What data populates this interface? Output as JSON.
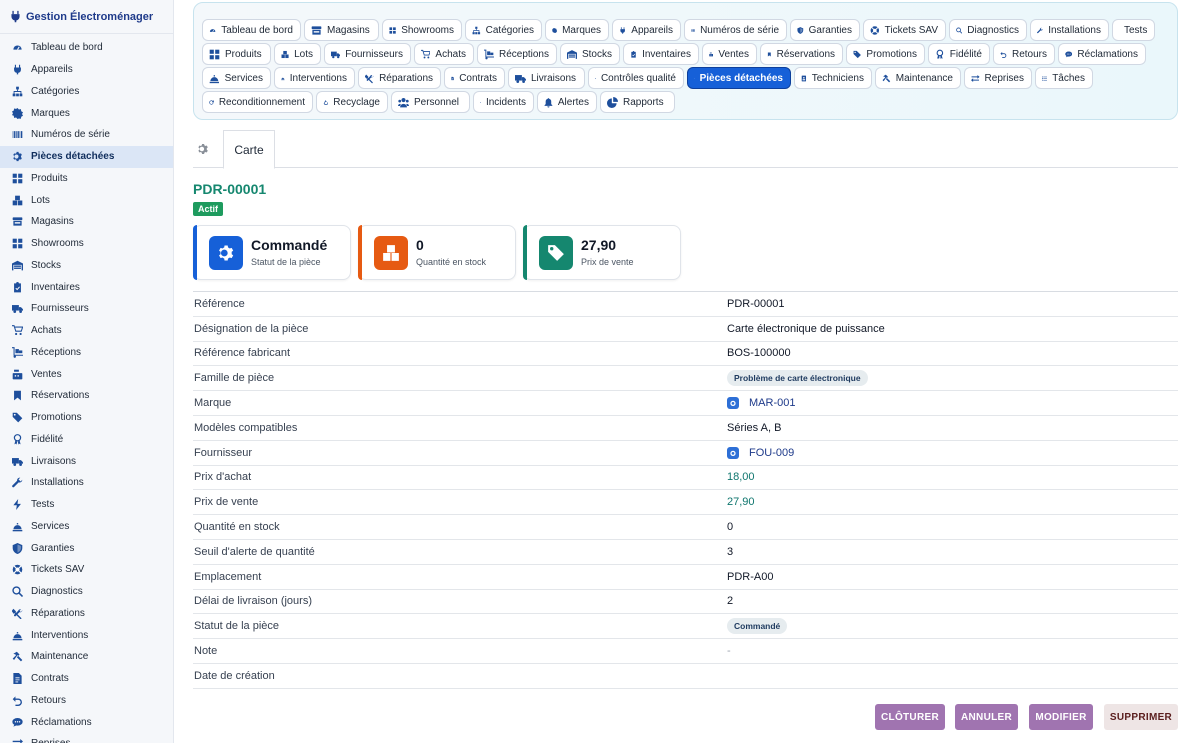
{
  "app": {
    "title": "Gestion Électroménager"
  },
  "colors": {
    "primary_blue": "#1660d8",
    "teal": "#15876f",
    "orange": "#e65a12",
    "green": "#1e9b5e",
    "purple_button": "#a074b0"
  },
  "sidebar": {
    "active": "Pièces détachées",
    "items": [
      {
        "label": "Tableau de bord",
        "icon": "dashboard-icon"
      },
      {
        "label": "Appareils",
        "icon": "plug-icon"
      },
      {
        "label": "Catégories",
        "icon": "sitemap-icon"
      },
      {
        "label": "Marques",
        "icon": "badge-icon"
      },
      {
        "label": "Numéros de série",
        "icon": "barcode-icon"
      },
      {
        "label": "Pièces détachées",
        "icon": "gear-icon"
      },
      {
        "label": "Produits",
        "icon": "grid-icon"
      },
      {
        "label": "Lots",
        "icon": "boxes-icon"
      },
      {
        "label": "Magasins",
        "icon": "store-icon"
      },
      {
        "label": "Showrooms",
        "icon": "showroom-icon"
      },
      {
        "label": "Stocks",
        "icon": "warehouse-icon"
      },
      {
        "label": "Inventaires",
        "icon": "clipboard-icon"
      },
      {
        "label": "Fournisseurs",
        "icon": "truck-icon"
      },
      {
        "label": "Achats",
        "icon": "cart-icon"
      },
      {
        "label": "Réceptions",
        "icon": "dolly-icon"
      },
      {
        "label": "Ventes",
        "icon": "cash-register-icon"
      },
      {
        "label": "Réservations",
        "icon": "bookmark-icon"
      },
      {
        "label": "Promotions",
        "icon": "tags-icon"
      },
      {
        "label": "Fidélité",
        "icon": "award-icon"
      },
      {
        "label": "Livraisons",
        "icon": "truck-icon"
      },
      {
        "label": "Installations",
        "icon": "wrench-icon"
      },
      {
        "label": "Tests",
        "icon": "bolt-icon"
      },
      {
        "label": "Services",
        "icon": "service-icon"
      },
      {
        "label": "Garanties",
        "icon": "shield-icon"
      },
      {
        "label": "Tickets SAV",
        "icon": "lifebuoy-icon"
      },
      {
        "label": "Diagnostics",
        "icon": "search-icon"
      },
      {
        "label": "Réparations",
        "icon": "tools-icon"
      },
      {
        "label": "Interventions",
        "icon": "service-icon"
      },
      {
        "label": "Maintenance",
        "icon": "hammer-icon"
      },
      {
        "label": "Contrats",
        "icon": "file-icon"
      },
      {
        "label": "Retours",
        "icon": "undo-icon"
      },
      {
        "label": "Réclamations",
        "icon": "comment-icon"
      },
      {
        "label": "Reprises",
        "icon": "exchange-icon"
      }
    ]
  },
  "tabs": {
    "row1": [
      {
        "label": "Tableau de bord",
        "icon": "dashboard-icon"
      },
      {
        "label": "Magasins",
        "icon": "store-icon"
      },
      {
        "label": "Showrooms",
        "icon": "showroom-icon"
      },
      {
        "label": "Catégories",
        "icon": "sitemap-icon"
      },
      {
        "label": "Marques",
        "icon": "badge-icon"
      },
      {
        "label": "Appareils",
        "icon": "plug-icon"
      },
      {
        "label": "Numéros de série",
        "icon": "barcode-icon"
      },
      {
        "label": "Garanties",
        "icon": "shield-icon"
      },
      {
        "label": "Tickets SAV",
        "icon": "lifebuoy-icon"
      },
      {
        "label": "Diagnostics",
        "icon": "search-icon"
      },
      {
        "label": "Installations",
        "icon": "wrench-icon"
      },
      {
        "label": "Tests",
        "icon": "bolt-icon"
      }
    ],
    "row2": [
      {
        "label": "Produits",
        "icon": "grid-icon"
      },
      {
        "label": "Lots",
        "icon": "boxes-icon"
      },
      {
        "label": "Fournisseurs",
        "icon": "truck-icon"
      },
      {
        "label": "Achats",
        "icon": "cart-icon"
      },
      {
        "label": "Réceptions",
        "icon": "dolly-icon"
      },
      {
        "label": "Stocks",
        "icon": "warehouse-icon"
      },
      {
        "label": "Inventaires",
        "icon": "clipboard-icon"
      },
      {
        "label": "Ventes",
        "icon": "cash-register-icon"
      },
      {
        "label": "Réservations",
        "icon": "bookmark-icon"
      },
      {
        "label": "Promotions",
        "icon": "tags-icon"
      },
      {
        "label": "Fidélité",
        "icon": "award-icon"
      },
      {
        "label": "Retours",
        "icon": "undo-icon"
      },
      {
        "label": "Réclamations",
        "icon": "comment-icon"
      }
    ],
    "row3": [
      {
        "label": "Services",
        "icon": "service-icon"
      },
      {
        "label": "Interventions",
        "icon": "service-icon"
      },
      {
        "label": "Réparations",
        "icon": "tools-icon"
      },
      {
        "label": "Contrats",
        "icon": "file-icon"
      },
      {
        "label": "Livraisons",
        "icon": "truck-icon"
      },
      {
        "label": "Contrôles qualité",
        "icon": "clipboard-icon"
      },
      {
        "label": "Pièces détachées",
        "icon": "gear-icon",
        "active": true
      },
      {
        "label": "Techniciens",
        "icon": "id-card-icon"
      },
      {
        "label": "Maintenance",
        "icon": "hammer-icon"
      },
      {
        "label": "Reprises",
        "icon": "exchange-icon"
      },
      {
        "label": "Tâches",
        "icon": "list-icon"
      }
    ],
    "row4": [
      {
        "label": "Reconditionnement",
        "icon": "redo-icon"
      },
      {
        "label": "Recyclage",
        "icon": "recycle-icon"
      },
      {
        "label": "Personnel",
        "icon": "users-icon"
      },
      {
        "label": "Incidents",
        "icon": "warning-icon"
      },
      {
        "label": "Alertes",
        "icon": "bell-icon"
      },
      {
        "label": "Rapports",
        "icon": "pie-icon"
      }
    ]
  },
  "subtabs": {
    "carte": "Carte"
  },
  "record": {
    "id": "PDR-00001",
    "status": "Actif",
    "cards": [
      {
        "value": "Commandé",
        "label": "Statut de la pièce",
        "icon": "gear-icon",
        "color": "#1660d8"
      },
      {
        "value": "0",
        "label": "Quantité en stock",
        "icon": "boxes-icon",
        "color": "#e65a12"
      },
      {
        "value": "27,90",
        "label": "Prix de vente",
        "icon": "tag-icon",
        "color": "#15876f"
      }
    ],
    "fields": [
      {
        "label": "Référence",
        "value": "PDR-00001",
        "kind": "text"
      },
      {
        "label": "Désignation de la pièce",
        "value": "Carte électronique de puissance",
        "kind": "text"
      },
      {
        "label": "Référence fabricant",
        "value": "BOS-100000",
        "kind": "text"
      },
      {
        "label": "Famille de pièce",
        "value": "Problème de carte électronique",
        "kind": "badge"
      },
      {
        "label": "Marque",
        "value": "MAR-001",
        "kind": "link"
      },
      {
        "label": "Modèles compatibles",
        "value": "Séries A, B",
        "kind": "text"
      },
      {
        "label": "Fournisseur",
        "value": "FOU-009",
        "kind": "link"
      },
      {
        "label": "Prix d'achat",
        "value": "18,00",
        "kind": "money"
      },
      {
        "label": "Prix de vente",
        "value": "27,90",
        "kind": "money"
      },
      {
        "label": "Quantité en stock",
        "value": "0",
        "kind": "text"
      },
      {
        "label": "Seuil d'alerte de quantité",
        "value": "3",
        "kind": "text"
      },
      {
        "label": "Emplacement",
        "value": "PDR-A00",
        "kind": "text"
      },
      {
        "label": "Délai de livraison (jours)",
        "value": "2",
        "kind": "text"
      },
      {
        "label": "Statut de la pièce",
        "value": "Commandé",
        "kind": "badge"
      },
      {
        "label": "Note",
        "value": "-",
        "kind": "muted"
      },
      {
        "label": "Date de création",
        "value": "",
        "kind": "text"
      }
    ]
  },
  "actions": {
    "close": "CLÔTURER",
    "cancel": "ANNULER",
    "edit": "MODIFIER",
    "delete": "SUPPRIMER"
  }
}
